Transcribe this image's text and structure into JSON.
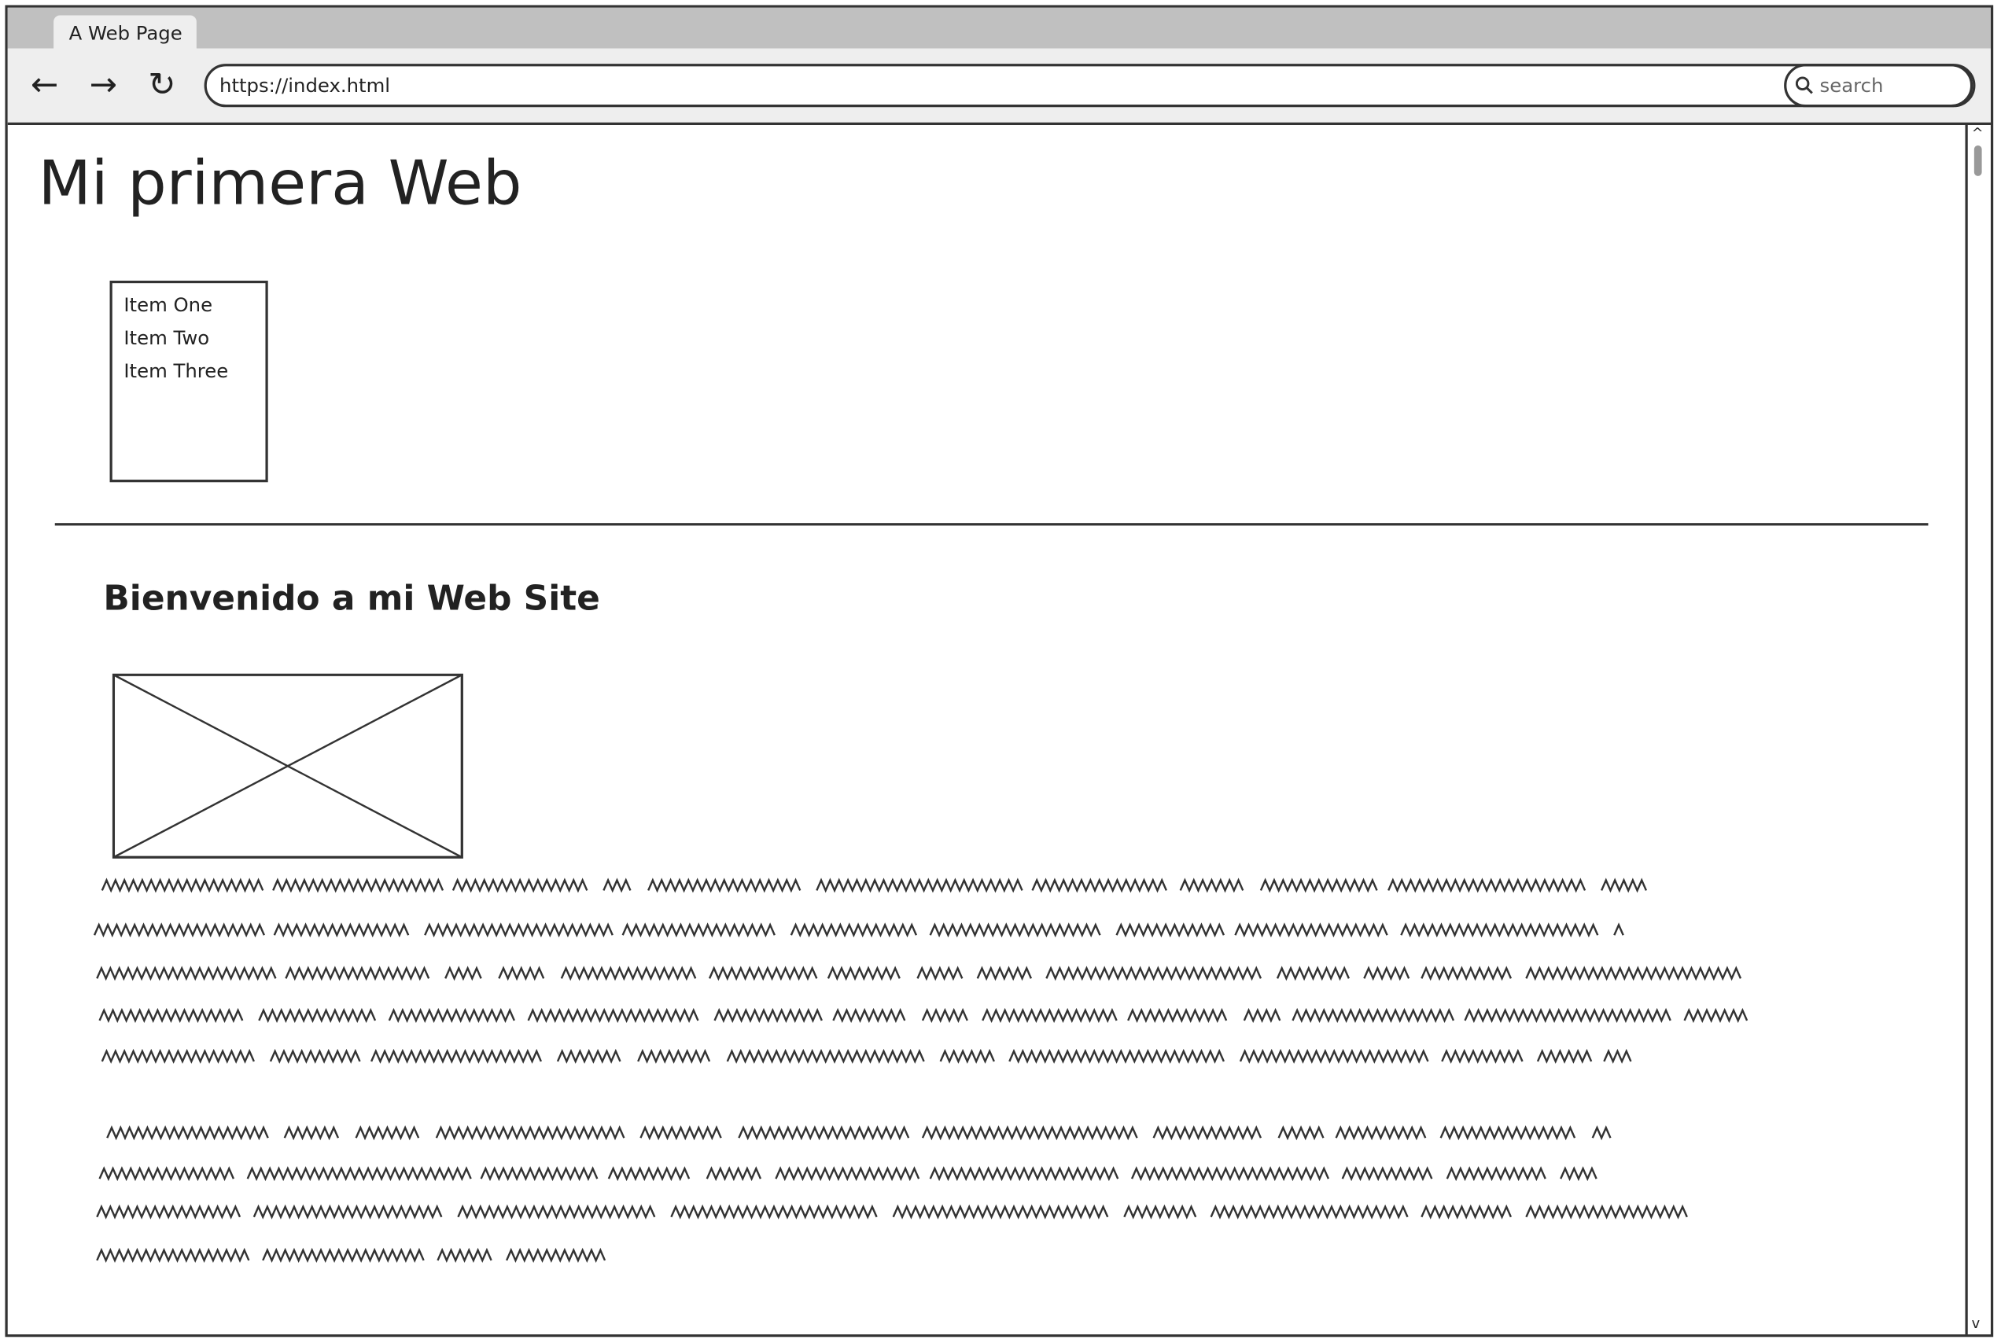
{
  "browser": {
    "tab_title": "A Web Page",
    "url": "https://index.html",
    "search_placeholder": "search",
    "icons": [
      "back-arrow-icon",
      "forward-arrow-icon",
      "reload-icon",
      "search-icon"
    ]
  },
  "page": {
    "title": "Mi primera Web",
    "list_items": [
      "Item One",
      "Item Two",
      "Item Three"
    ],
    "heading": "Bienvenido a mi Web Site",
    "image_placeholder": "image-placeholder"
  }
}
